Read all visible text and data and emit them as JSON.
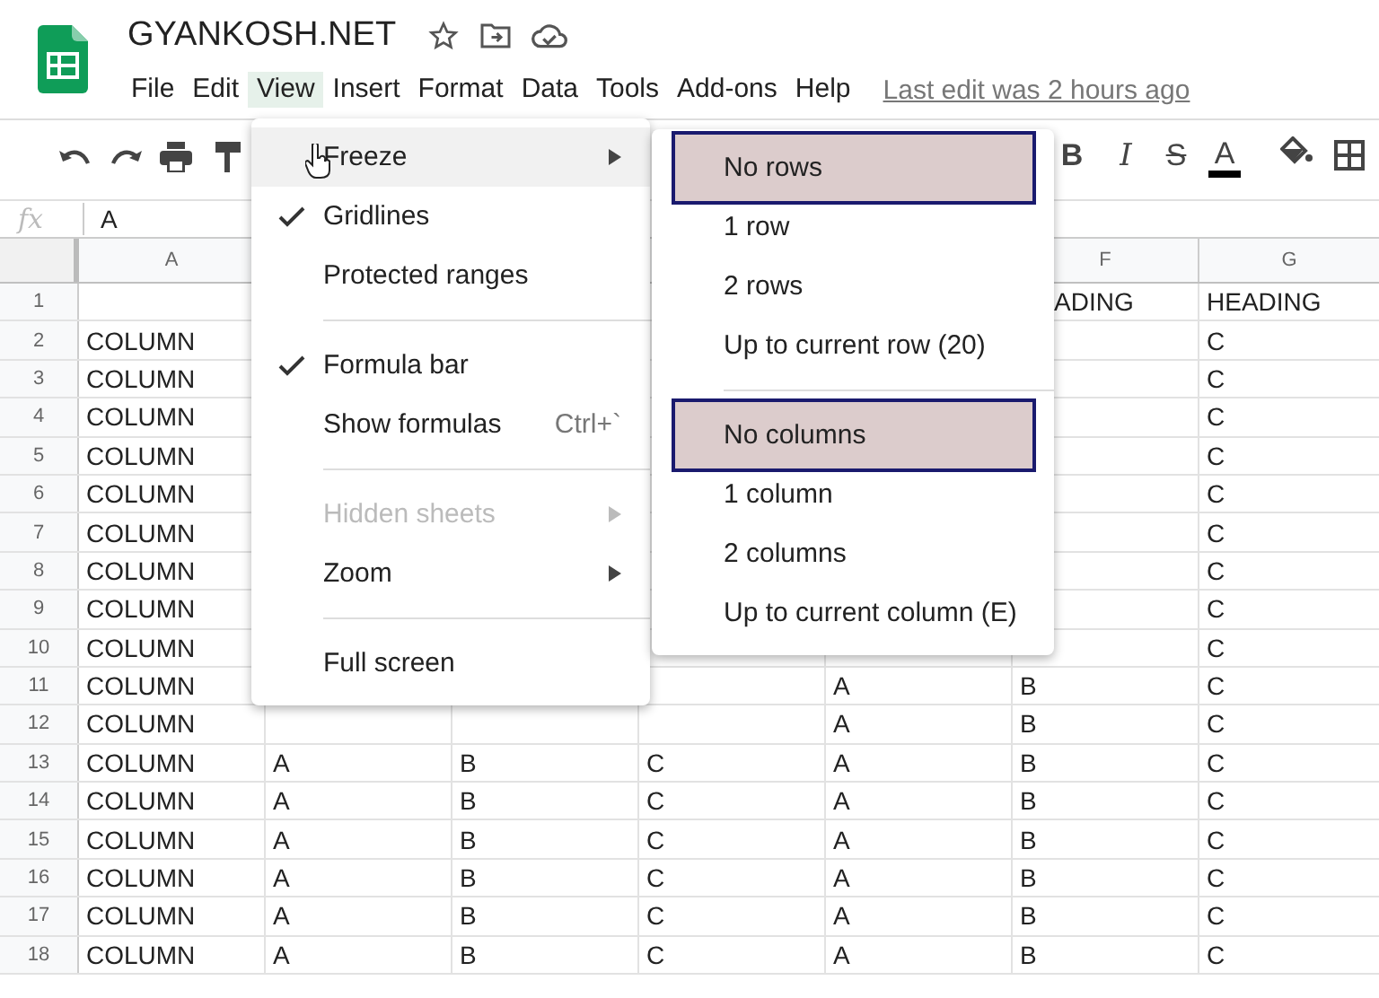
{
  "app": {
    "title": "GYANKOSH.NET"
  },
  "menubar": [
    {
      "label": "File",
      "selected": false
    },
    {
      "label": "Edit",
      "selected": false
    },
    {
      "label": "View",
      "selected": true
    },
    {
      "label": "Insert",
      "selected": false
    },
    {
      "label": "Format",
      "selected": false
    },
    {
      "label": "Data",
      "selected": false
    },
    {
      "label": "Tools",
      "selected": false
    },
    {
      "label": "Add-ons",
      "selected": false
    },
    {
      "label": "Help",
      "selected": false
    }
  ],
  "last_edit": "Last edit was 2 hours ago",
  "toolbar": {
    "format_buttons": [
      "B",
      "I",
      "S",
      "A"
    ]
  },
  "formula_bar": {
    "label": "fx",
    "value": "A"
  },
  "grid": {
    "columns": [
      "A",
      null,
      null,
      null,
      null,
      "F",
      "G"
    ],
    "rows": [
      {
        "number": "1",
        "cells": [
          null,
          null,
          null,
          null,
          null,
          "ADING",
          "HEADING"
        ]
      },
      {
        "number": "2",
        "cells": [
          "COLUMN",
          null,
          null,
          null,
          null,
          null,
          "C"
        ]
      },
      {
        "number": "3",
        "cells": [
          "COLUMN",
          null,
          null,
          null,
          null,
          null,
          "C"
        ]
      },
      {
        "number": "4",
        "cells": [
          "COLUMN",
          null,
          null,
          null,
          null,
          null,
          "C"
        ]
      },
      {
        "number": "5",
        "cells": [
          "COLUMN",
          null,
          null,
          null,
          null,
          null,
          "C"
        ]
      },
      {
        "number": "6",
        "cells": [
          "COLUMN",
          null,
          null,
          null,
          null,
          null,
          "C"
        ]
      },
      {
        "number": "7",
        "cells": [
          "COLUMN",
          null,
          null,
          null,
          null,
          null,
          "C"
        ]
      },
      {
        "number": "8",
        "cells": [
          "COLUMN",
          null,
          null,
          null,
          null,
          null,
          "C"
        ]
      },
      {
        "number": "9",
        "cells": [
          "COLUMN",
          null,
          null,
          null,
          null,
          null,
          "C"
        ]
      },
      {
        "number": "10",
        "cells": [
          "COLUMN",
          null,
          null,
          null,
          null,
          null,
          "C"
        ]
      },
      {
        "number": "11",
        "cells": [
          "COLUMN",
          null,
          null,
          null,
          "A",
          "B",
          "C"
        ]
      },
      {
        "number": "12",
        "cells": [
          "COLUMN",
          null,
          null,
          null,
          "A",
          "B",
          "C"
        ]
      },
      {
        "number": "13",
        "cells": [
          "COLUMN",
          "A",
          "B",
          "C",
          "A",
          "B",
          "C"
        ]
      },
      {
        "number": "14",
        "cells": [
          "COLUMN",
          "A",
          "B",
          "C",
          "A",
          "B",
          "C"
        ]
      },
      {
        "number": "15",
        "cells": [
          "COLUMN",
          "A",
          "B",
          "C",
          "A",
          "B",
          "C"
        ]
      },
      {
        "number": "16",
        "cells": [
          "COLUMN",
          "A",
          "B",
          "C",
          "A",
          "B",
          "C"
        ]
      },
      {
        "number": "17",
        "cells": [
          "COLUMN",
          "A",
          "B",
          "C",
          "A",
          "B",
          "C"
        ]
      },
      {
        "number": "18",
        "cells": [
          "COLUMN",
          "A",
          "B",
          "C",
          "A",
          "B",
          "C"
        ]
      }
    ]
  },
  "view_menu": {
    "items": [
      {
        "kind": "item",
        "label": "Freeze",
        "selected": true,
        "checked": false,
        "disabled": false,
        "submenu": true
      },
      {
        "kind": "item",
        "label": "Gridlines",
        "selected": false,
        "checked": true,
        "disabled": false,
        "submenu": false
      },
      {
        "kind": "item",
        "label": "Protected ranges",
        "selected": false,
        "checked": false,
        "disabled": false,
        "submenu": false
      },
      {
        "kind": "separator"
      },
      {
        "kind": "item",
        "label": "Formula bar",
        "selected": false,
        "checked": true,
        "disabled": false,
        "submenu": false
      },
      {
        "kind": "item",
        "label": "Show formulas",
        "shortcut": "Ctrl+`",
        "selected": false,
        "checked": false,
        "disabled": false,
        "submenu": false
      },
      {
        "kind": "separator"
      },
      {
        "kind": "item",
        "label": "Hidden sheets",
        "selected": false,
        "checked": false,
        "disabled": true,
        "submenu": true
      },
      {
        "kind": "item",
        "label": "Zoom",
        "selected": false,
        "checked": false,
        "disabled": false,
        "submenu": true
      },
      {
        "kind": "separator"
      },
      {
        "kind": "item",
        "label": "Full screen",
        "selected": false,
        "checked": false,
        "disabled": false,
        "submenu": false
      }
    ]
  },
  "freeze_submenu": {
    "items": [
      {
        "kind": "item",
        "label": "No rows",
        "highlighted": true
      },
      {
        "kind": "item",
        "label": "1 row",
        "highlighted": false
      },
      {
        "kind": "item",
        "label": "2 rows",
        "highlighted": false
      },
      {
        "kind": "item",
        "label": "Up to current row (20)",
        "highlighted": false
      },
      {
        "kind": "separator"
      },
      {
        "kind": "item",
        "label": "No columns",
        "highlighted": true
      },
      {
        "kind": "item",
        "label": "1 column",
        "highlighted": false
      },
      {
        "kind": "item",
        "label": "2 columns",
        "highlighted": false
      },
      {
        "kind": "item",
        "label": "Up to current column (E)",
        "highlighted": false
      }
    ]
  }
}
